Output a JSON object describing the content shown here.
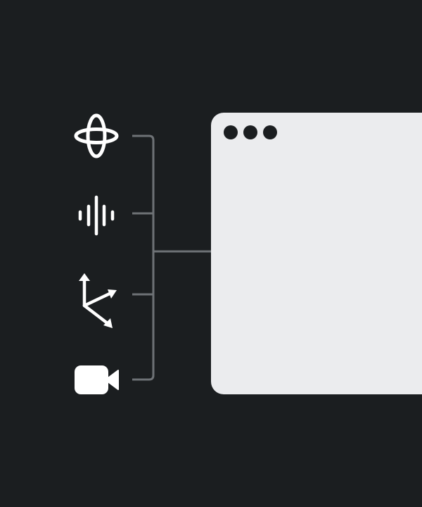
{
  "colors": {
    "background": "#1b1e20",
    "icon": "#ffffff",
    "connector": "#6e7276",
    "window": "#ebecee",
    "window_dot": "#1b1e20"
  },
  "icons": [
    {
      "name": "orbit-3d-icon"
    },
    {
      "name": "audio-waveform-icon"
    },
    {
      "name": "axes-3d-icon"
    },
    {
      "name": "video-camera-icon"
    }
  ],
  "window": {
    "dots": 3
  }
}
